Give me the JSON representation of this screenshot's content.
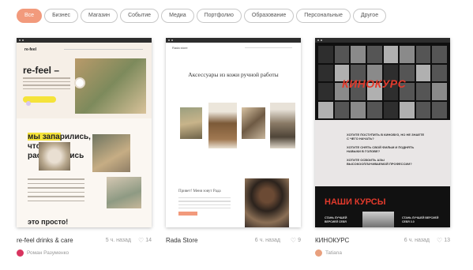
{
  "filters": [
    {
      "label": "Все",
      "active": true
    },
    {
      "label": "Бизнес",
      "active": false
    },
    {
      "label": "Магазин",
      "active": false
    },
    {
      "label": "Событие",
      "active": false
    },
    {
      "label": "Медиа",
      "active": false
    },
    {
      "label": "Портфолио",
      "active": false
    },
    {
      "label": "Образование",
      "active": false
    },
    {
      "label": "Персональные",
      "active": false
    },
    {
      "label": "Другое",
      "active": false
    }
  ],
  "accent_color": "#f29a7c",
  "cards": [
    {
      "title": "re-feel drinks & care",
      "time": "5 ч. назад",
      "likes": "14",
      "author": "Роман Разуменко",
      "avatar_color": "#d8345f",
      "preview": {
        "logo": "re-feel",
        "hero": "re-feel –",
        "headline": "мы запарились, чтобы вы расслабились",
        "bottom": "это просто!"
      }
    },
    {
      "title": "Rada Store",
      "time": "6 ч. назад",
      "likes": "9",
      "author": "",
      "avatar_color": "",
      "preview": {
        "logo": "Rada store",
        "hero": "Аксессуары из кожи ручной работы",
        "sub": "Привет! Меня зовут Рада"
      }
    },
    {
      "title": "КИНОКУРС",
      "time": "6 ч. назад",
      "likes": "13",
      "author": "Tatiana",
      "avatar_color": "#e8a07e",
      "preview": {
        "big": "КИНОКУРС",
        "q1": "ХОТИТЕ ПОСТУПИТЬ В КИНОВУЗ, НО НЕ ЗНАЕТЕ С ЧЕГО НАЧАТЬ?",
        "q2": "ХОТИТЕ СНЯТЬ СВОЙ ФИЛЬМ И ПОДНЯТЬ НАВЫКИ В ГОЛОВЕ?",
        "q3": "ХОТИТЕ ОСВОИТЬ АЗЫ ВЫСОКООПЛАЧИВАЕМОЙ ПРОФЕССИИ?",
        "courses": "НАШИ КУРСЫ",
        "course1": "СТАНЬ ЛУЧШЕЙ ВЕРСИЕЙ СЕБЯ",
        "course2": "СТАНЬ ЛУЧШЕЙ ВЕРСИЕЙ СЕБЯ 3.0"
      }
    }
  ],
  "icons": {
    "like": "heart-icon"
  }
}
